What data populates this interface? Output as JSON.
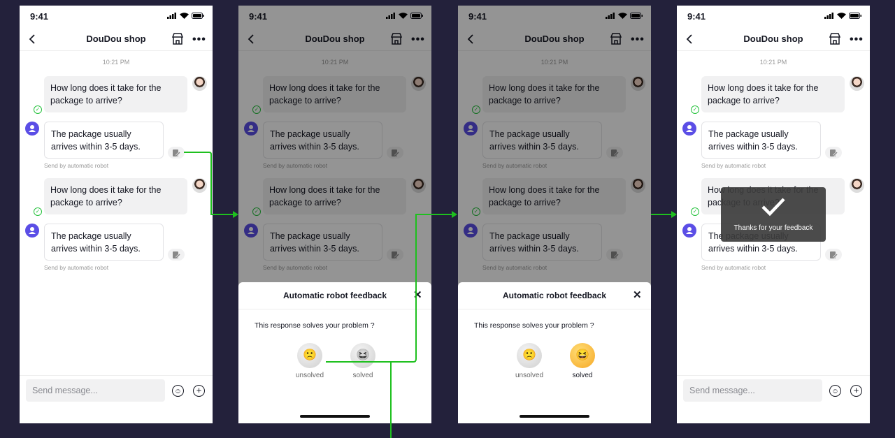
{
  "status_time": "9:41",
  "header": {
    "title": "DouDou shop"
  },
  "chat": {
    "timestamp": "10:21 PM",
    "user_message": "How long does it take for the package to arrive?",
    "bot_message": "The package usually arrives within 3-5 days.",
    "bot_caption": "Send by automatic robot"
  },
  "input": {
    "placeholder": "Send message..."
  },
  "feedback_sheet": {
    "title": "Automatic robot feedback",
    "question": "This response solves your problem ?",
    "options": [
      {
        "label": "unsolved",
        "icon": "sad-face-icon"
      },
      {
        "label": "solved",
        "icon": "laughing-face-icon"
      }
    ]
  },
  "toast": {
    "text": "Thanks for your feedback"
  },
  "colors": {
    "background": "#23213b",
    "flow_arrow": "#1ec01e",
    "robot_avatar": "#5b4ee6",
    "selected_face": "#f6a623"
  },
  "screens": [
    {
      "state": "chat"
    },
    {
      "state": "feedback-sheet"
    },
    {
      "state": "feedback-solved-selected"
    },
    {
      "state": "thanks-toast"
    }
  ]
}
